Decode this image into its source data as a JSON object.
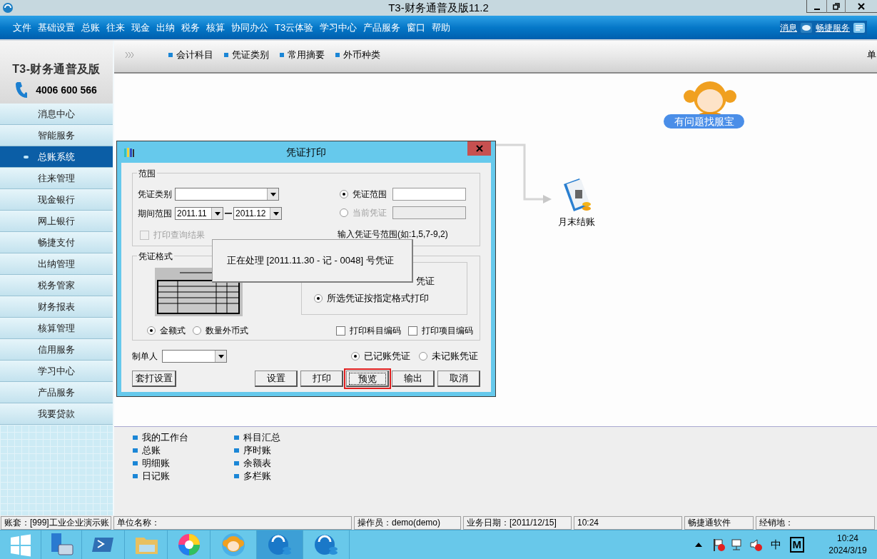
{
  "window": {
    "title": "T3-财务通普及版11.2"
  },
  "menu": [
    "文件",
    "基础设置",
    "总账",
    "往来",
    "现金",
    "出纳",
    "税务",
    "核算",
    "协同办公",
    "T3云体验",
    "学习中心",
    "产品服务",
    "窗口",
    "帮助"
  ],
  "menu_links": [
    {
      "label": "消息"
    },
    {
      "label": "畅捷服务"
    }
  ],
  "sidebar": {
    "brand": "T3-财务通普及版",
    "phone": "4006 600 566",
    "items": [
      {
        "label": "消息中心",
        "selected": false
      },
      {
        "label": "智能服务",
        "selected": false
      },
      {
        "label": "总账系统",
        "selected": true
      },
      {
        "label": "往来管理",
        "selected": false
      },
      {
        "label": "现金银行",
        "selected": false
      },
      {
        "label": "网上银行",
        "selected": false
      },
      {
        "label": "畅捷支付",
        "selected": false
      },
      {
        "label": "出纳管理",
        "selected": false
      },
      {
        "label": "税务管家",
        "selected": false
      },
      {
        "label": "财务报表",
        "selected": false
      },
      {
        "label": "核算管理",
        "selected": false
      },
      {
        "label": "信用服务",
        "selected": false
      },
      {
        "label": "学习中心",
        "selected": false
      },
      {
        "label": "产品服务",
        "selected": false
      },
      {
        "label": "我要贷款",
        "selected": false
      }
    ]
  },
  "toolbar": {
    "items": [
      "会计科目",
      "凭证类别",
      "常用摘要",
      "外币种类"
    ],
    "cut_text": "单"
  },
  "help_badge": "有问题找服宝",
  "flow": {
    "nodes": [
      {
        "label": "月末结账"
      }
    ]
  },
  "links": [
    {
      "items": [
        "我的工作台",
        "总账",
        "明细账",
        "日记账"
      ]
    },
    {
      "items": [
        "科目汇总",
        "序时账",
        "余额表",
        "多栏账"
      ]
    }
  ],
  "dialog": {
    "title": "凭证打印",
    "range": {
      "legend": "范围",
      "voucher_type_label": "凭证类别",
      "period_label": "期间范围",
      "period_from": "2011.11",
      "period_to": "2011.12",
      "print_query": {
        "label": "打印查询结果",
        "checked": false,
        "disabled": true
      },
      "options": [
        {
          "label": "凭证范围",
          "selected": true,
          "disabled": false
        },
        {
          "label": "当前凭证",
          "selected": false,
          "disabled": true
        }
      ],
      "hint": "输入凭证号范围(如:1,5,7-9,2)"
    },
    "format": {
      "legend": "凭证格式",
      "styles": [
        {
          "label": "金额式",
          "selected": true
        },
        {
          "label": "数量外币式",
          "selected": false
        }
      ],
      "partial_text": "凭证",
      "format_option": {
        "label": "所选凭证按指定格式打印",
        "selected": true
      },
      "checkboxes": [
        {
          "label": "打印科目编码",
          "checked": false
        },
        {
          "label": "打印项目编码",
          "checked": false
        }
      ]
    },
    "maker_label": "制单人",
    "posted": [
      {
        "label": "已记账凭证",
        "selected": true
      },
      {
        "label": "未记账凭证",
        "selected": false
      }
    ],
    "buttons": [
      {
        "label": "套打设置",
        "focused": false
      },
      {
        "label": "设置",
        "focused": false
      },
      {
        "label": "打印",
        "focused": false
      },
      {
        "label": "预览",
        "focused": true
      },
      {
        "label": "输出",
        "focused": false
      },
      {
        "label": "取消",
        "focused": false
      }
    ]
  },
  "progress": "正在处理 [2011.11.30 - 记 - 0048] 号凭证",
  "status_bar": [
    "账套：[999]工业企业演示账",
    "单位名称：",
    "操作员：demo(demo)",
    "业务日期：[2011/12/15]",
    "10:24",
    "畅捷通软件",
    "经销地："
  ],
  "taskbar": {
    "apps": [
      {
        "kind": "start",
        "selected": false
      },
      {
        "kind": "server",
        "selected": false
      },
      {
        "kind": "shell",
        "selected": false
      },
      {
        "kind": "folder",
        "selected": false
      },
      {
        "kind": "swirl",
        "selected": false
      },
      {
        "kind": "mascot",
        "selected": false
      },
      {
        "kind": "t3",
        "selected": true
      },
      {
        "kind": "t3",
        "selected": false
      }
    ],
    "ime": "中",
    "keyboard": "M",
    "time": "10:24",
    "date": "2024/3/19"
  }
}
